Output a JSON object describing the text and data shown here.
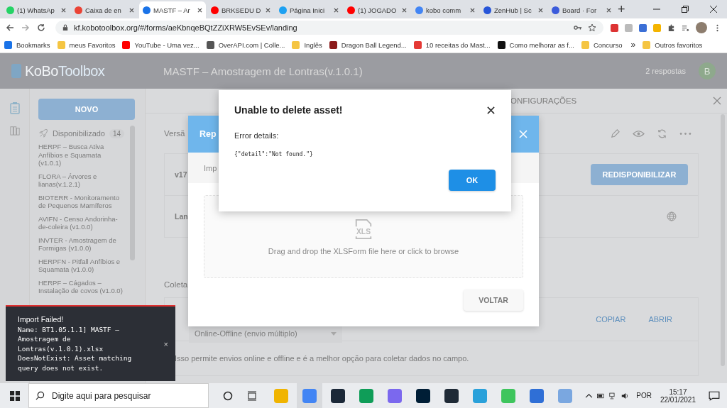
{
  "browser": {
    "tabs": [
      {
        "label": "(1) WhatsAp",
        "selected": false,
        "color": "#25d366"
      },
      {
        "label": "Caixa de en",
        "selected": false,
        "color": "#ea4335"
      },
      {
        "label": "MASTF – Ar",
        "selected": true,
        "color": "#1a73e8"
      },
      {
        "label": "BRKSEDU D",
        "selected": false,
        "color": "#ff0000"
      },
      {
        "label": "Página Inici",
        "selected": false,
        "color": "#1da1f2"
      },
      {
        "label": "(1) JOGADO",
        "selected": false,
        "color": "#ff0000"
      },
      {
        "label": "kobo comm",
        "selected": false,
        "color": "#4285f4"
      },
      {
        "label": "ZenHub | Sc",
        "selected": false,
        "color": "#2755d8"
      },
      {
        "label": "Board · For",
        "selected": false,
        "color": "#3b5bdb"
      }
    ],
    "new_tab": "+",
    "url": "kf.kobotoolbox.org/#/forms/aeKbnqeBQtZZiXRW5EvSEv/landing",
    "bookmarks": [
      {
        "label": "Bookmarks",
        "color": "#1a73e8"
      },
      {
        "label": "meus Favoritos",
        "color": "#f5c542"
      },
      {
        "label": "YouTube - Uma vez...",
        "color": "#ff0000"
      },
      {
        "label": "OverAPI.com | Colle...",
        "color": "#555555"
      },
      {
        "label": "Inglês",
        "color": "#f5c542"
      },
      {
        "label": "Dragon Ball Legend...",
        "color": "#8b1a1a"
      },
      {
        "label": "10 receitas do Mast...",
        "color": "#e53935"
      },
      {
        "label": "Como melhorar as f...",
        "color": "#111111"
      },
      {
        "label": "Concurso",
        "color": "#f5c542"
      }
    ],
    "more": "»",
    "other_bookmarks": "Outros favoritos"
  },
  "header": {
    "logo_prefix": "KoBo",
    "logo_suffix": "Toolbox",
    "title": "MASTF – Amostragem de Lontras(v.1.0.1)",
    "responses": "2 respostas",
    "avatar": "B"
  },
  "sidebar": {
    "new_button": "NOVO",
    "section": {
      "label": "Disponibilizado",
      "count": "14"
    },
    "items": [
      "HERPF – Busca Ativa Anfíbios e Squamata (v1.0.1)",
      "FLORA – Árvores e lianas(v.1.2.1)",
      "BIOTERR - Monitoramento de Pequenos Mamíferos",
      "AVIFN - Censo Andorinha-de-coleira (v1.0.0)",
      "INVTER - Amostragem de Formigas (v1.0.0)",
      "HERPFN - Pitfall Anfíbios e Squamata (v1.0.0)",
      "HERPF – Cágados – Instalação de covos (v1.0.0)"
    ]
  },
  "form": {
    "tab_fragment": "ONFIGURAÇÕES",
    "version_fragment": "Versã",
    "rows": [
      {
        "kind": "version",
        "label": "v17",
        "action": "REDISPONIBILIZAR"
      },
      {
        "kind": "language",
        "label": "Lan"
      }
    ],
    "collect_label": "Coleta",
    "collect_mode": "Online-Offline (envio múltiplo)",
    "copy": "COPIAR",
    "open": "ABRIR",
    "collect_help": "Isso permite envios online e offline e é a melhor opção para coletar dados no campo."
  },
  "replace_dialog": {
    "title_fragment": "Rep",
    "intro_fragment": "Imp",
    "icon_label": "XLS",
    "dropzone_text": "Drag and drop the XLSForm file here or click to browse",
    "back_button": "VOLTAR"
  },
  "alert": {
    "title": "Unable to delete asset!",
    "label": "Error details:",
    "details": "{\"detail\":\"Not found.\"}",
    "ok": "OK"
  },
  "toast": {
    "title": "Import Failed!",
    "lines": [
      "Name: BT1.05.1.1] MASTF –",
      "Amostragem de",
      "Lontras(v.1.0.1).xlsx",
      "DoesNotExist: Asset matching",
      "query does not exist."
    ],
    "close": "×"
  },
  "taskbar": {
    "search_placeholder": "Digite aqui para pesquisar",
    "language": "POR",
    "time": "15:17",
    "date": "22/01/2021"
  }
}
